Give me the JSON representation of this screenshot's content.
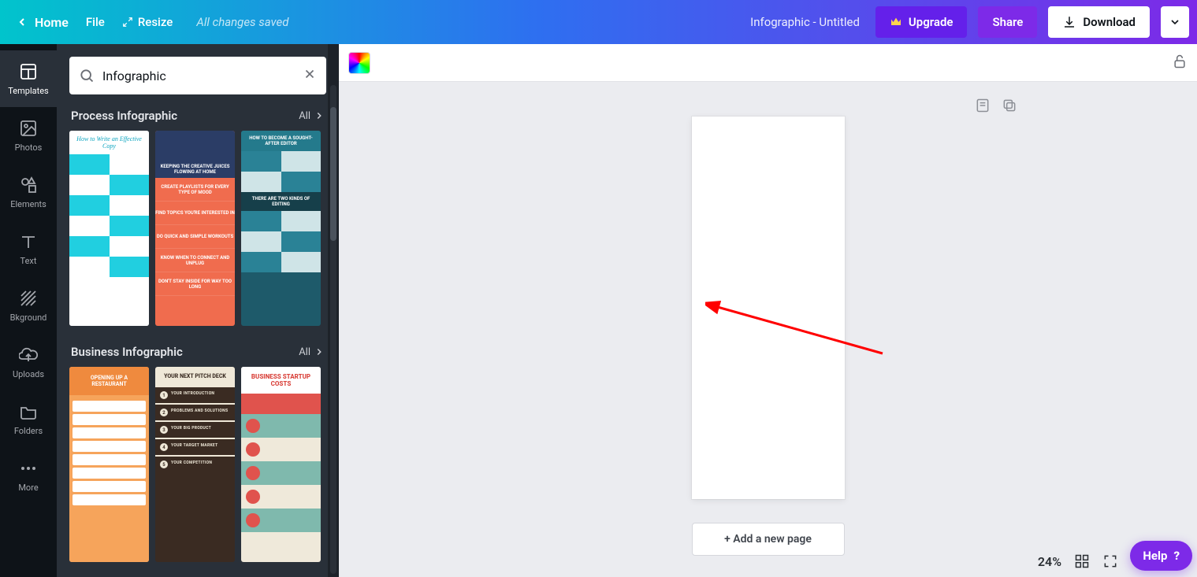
{
  "topbar": {
    "home": "Home",
    "file": "File",
    "resize": "Resize",
    "saved": "All changes saved",
    "doc_title": "Infographic - Untitled",
    "upgrade": "Upgrade",
    "share": "Share",
    "download": "Download"
  },
  "leftnav": {
    "items": [
      {
        "label": "Templates"
      },
      {
        "label": "Photos"
      },
      {
        "label": "Elements"
      },
      {
        "label": "Text"
      },
      {
        "label": "Bkground"
      },
      {
        "label": "Uploads"
      },
      {
        "label": "Folders"
      },
      {
        "label": "More"
      }
    ]
  },
  "search": {
    "value": "Infographic"
  },
  "sections": [
    {
      "title": "Process Infographic",
      "all": "All",
      "thumbs": [
        {
          "caption": "How to Write an Effective Copy"
        },
        {
          "caption": "KEEPING THE CREATIVE JUICES FLOWING AT HOME"
        },
        {
          "caption": "HOW TO BECOME A SOUGHT-AFTER EDITOR",
          "mid": "THERE ARE TWO KINDS OF EDITING"
        }
      ]
    },
    {
      "title": "Business Infographic",
      "all": "All",
      "thumbs": [
        {
          "caption": "OPENING UP A RESTAURANT"
        },
        {
          "caption": "YOUR NEXT PITCH DECK"
        },
        {
          "caption": "BUSINESS STARTUP COSTS"
        }
      ]
    }
  ],
  "canvas": {
    "add_page": "+ Add a new page",
    "zoom": "24%"
  },
  "help": {
    "label": "Help"
  }
}
